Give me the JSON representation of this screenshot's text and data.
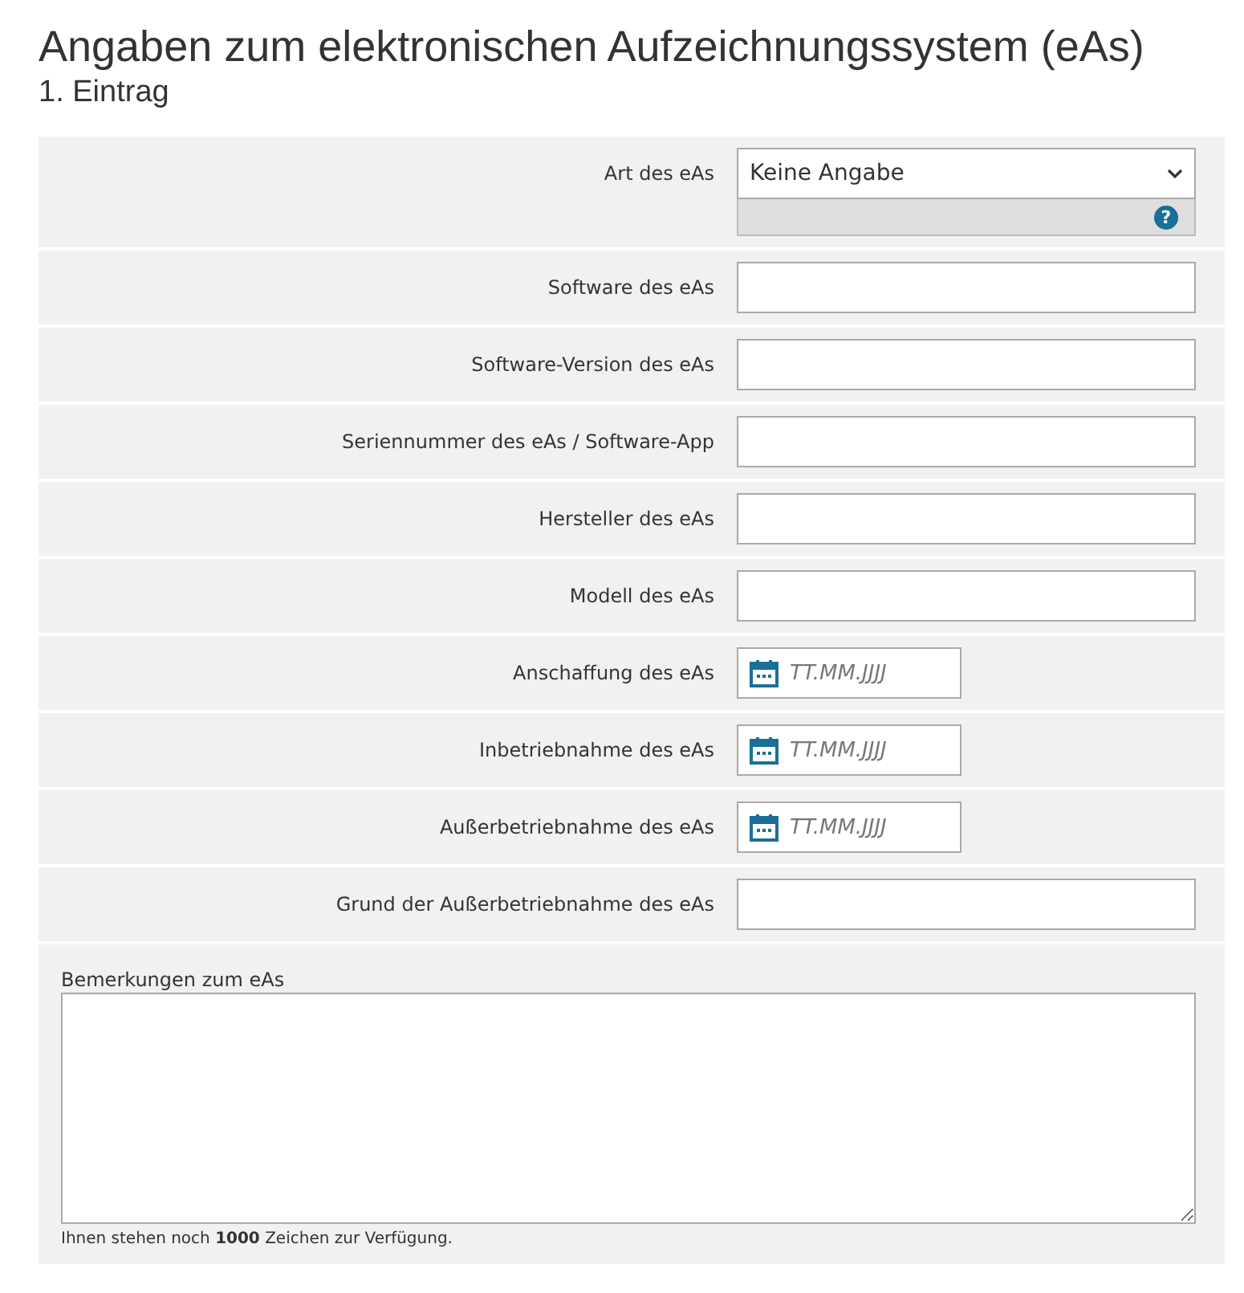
{
  "title": "Angaben zum elektronischen Aufzeichnungssystem (eAs)",
  "subtitle": "1. Eintrag",
  "rows": [
    {
      "kind": "select",
      "label": "Art des eAs",
      "value": "Keine Angabe",
      "help": "?"
    },
    {
      "kind": "text",
      "label": "Software des eAs"
    },
    {
      "kind": "text",
      "label": "Software-Version des eAs"
    },
    {
      "kind": "text",
      "label": "Seriennummer des eAs / Software-App"
    },
    {
      "kind": "text",
      "label": "Hersteller des eAs"
    },
    {
      "kind": "text",
      "label": "Modell des eAs"
    },
    {
      "kind": "date",
      "label": "Anschaffung des eAs",
      "placeholder": "TT.MM.JJJJ"
    },
    {
      "kind": "date",
      "label": "Inbetriebnahme des eAs",
      "placeholder": "TT.MM.JJJJ"
    },
    {
      "kind": "date",
      "label": "Außerbetriebnahme des eAs",
      "placeholder": "TT.MM.JJJJ"
    },
    {
      "kind": "text",
      "label": "Grund der Außerbetriebnahme des eAs"
    }
  ],
  "remarks": {
    "label": "Bemerkungen zum eAs",
    "hint": "Ihnen stehen noch **1000** Zeichen zur Verfügung."
  }
}
